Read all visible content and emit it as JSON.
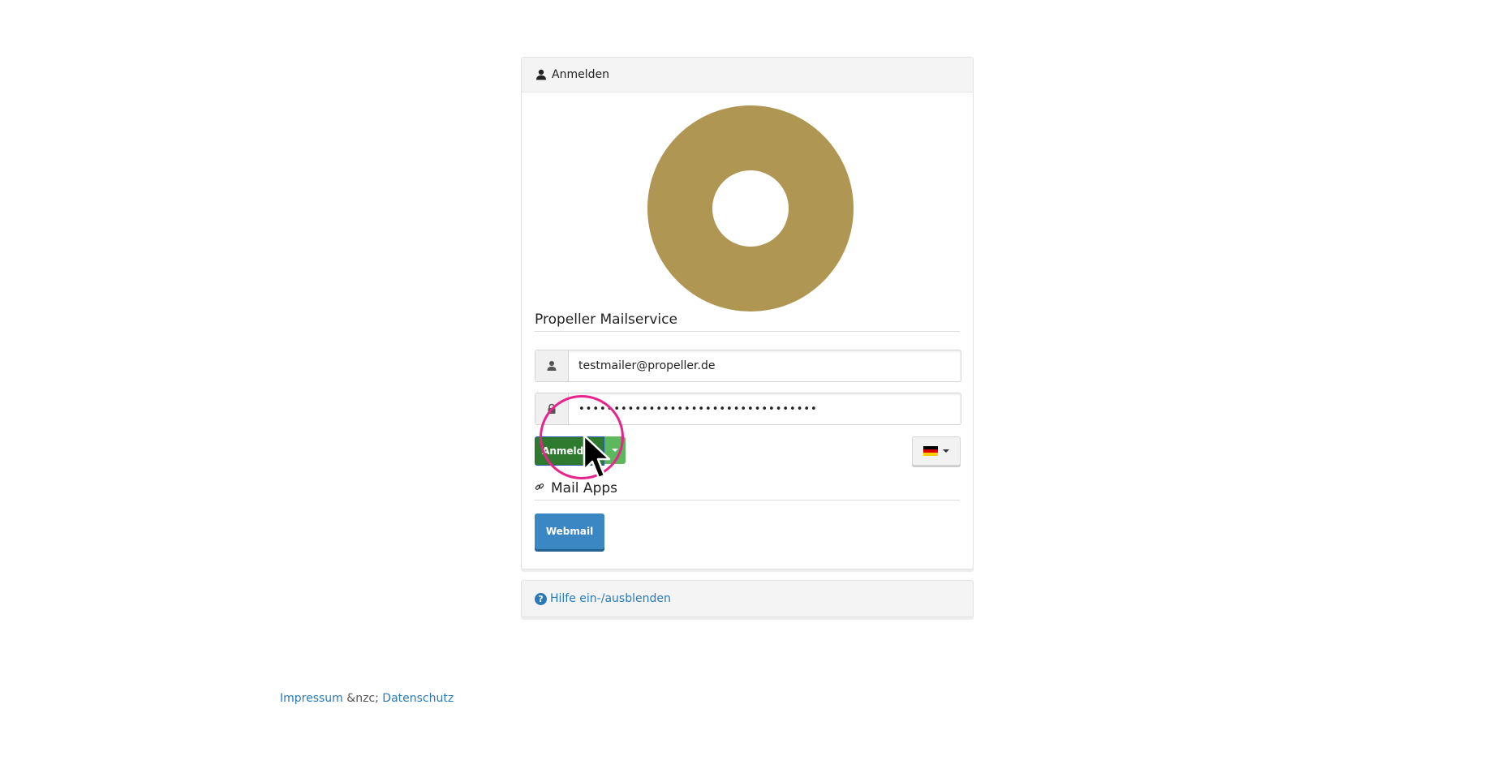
{
  "login_panel": {
    "header_title": "Anmelden",
    "org_name": "Propeller Mailservice",
    "logo_color": "#b09653",
    "username_value": "testmailer@propeller.de",
    "password_masked": "••••••••••••••••••••••••••••••••••",
    "login_button_label": "Anmelden",
    "login_button_color": "#2e7a2e",
    "language_selected": "de",
    "apps_section_title": "Mail Apps",
    "webmail_button_label": "Webmail",
    "webmail_button_color": "#3a87c4"
  },
  "help_panel": {
    "toggle_label": "Hilfe ein-/ausblenden"
  },
  "footer": {
    "impressum": "Impressum",
    "separator": "&nzc;",
    "datenschutz": "Datenschutz"
  },
  "overlay": {
    "click_highlight_color": "#e8248c"
  }
}
